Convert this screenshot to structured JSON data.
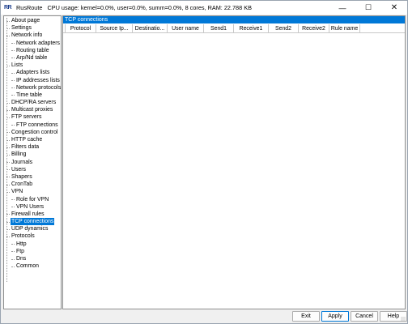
{
  "window": {
    "app_name": "RusRoute",
    "icon_text": "RR",
    "status": "CPU usage: kernel=0.0%, user=0.0%, summ=0.0%, 8 cores,  RAM: 22.788 KB",
    "minimize": "—",
    "maximize": "☐",
    "close": "✕"
  },
  "tree": {
    "items": [
      {
        "label": "About page",
        "level": 0
      },
      {
        "label": "Settings",
        "level": 0
      },
      {
        "label": "Network info",
        "level": 0
      },
      {
        "label": "Network adapters",
        "level": 1
      },
      {
        "label": "Routing table",
        "level": 1
      },
      {
        "label": "Arp/Nd table",
        "level": 1
      },
      {
        "label": "Lists",
        "level": 0
      },
      {
        "label": "Adapters lists",
        "level": 1
      },
      {
        "label": "IP addresses lists",
        "level": 1
      },
      {
        "label": "Network protocols",
        "level": 1
      },
      {
        "label": "Time table",
        "level": 1
      },
      {
        "label": "DHCP/RA servers",
        "level": 0
      },
      {
        "label": "Multicast proxies",
        "level": 0
      },
      {
        "label": "FTP servers",
        "level": 0
      },
      {
        "label": "FTP connections",
        "level": 1
      },
      {
        "label": "Congestion control",
        "level": 0
      },
      {
        "label": "HTTP cache",
        "level": 0
      },
      {
        "label": "Filters data",
        "level": 0
      },
      {
        "label": "Billing",
        "level": 0
      },
      {
        "label": "Journals",
        "level": 0
      },
      {
        "label": "Users",
        "level": 0
      },
      {
        "label": "Shapers",
        "level": 0
      },
      {
        "label": "CronTab",
        "level": 0
      },
      {
        "label": "VPN",
        "level": 0
      },
      {
        "label": "Role for VPN",
        "level": 1
      },
      {
        "label": "VPN Users",
        "level": 1
      },
      {
        "label": "Firewall rules",
        "level": 0
      },
      {
        "label": "TCP connections",
        "level": 0,
        "selected": true
      },
      {
        "label": "UDP dynamics",
        "level": 0
      },
      {
        "label": "Protocols",
        "level": 0
      },
      {
        "label": "Http",
        "level": 1
      },
      {
        "label": "Ftp",
        "level": 1
      },
      {
        "label": "Dns",
        "level": 1
      },
      {
        "label": "Common",
        "level": 1
      }
    ]
  },
  "main": {
    "title": "TCP connections",
    "columns": [
      "Protocol",
      "Source Ip...",
      "Destinatio...",
      "User name",
      "Send1",
      "Receive1",
      "Send2",
      "Receive2",
      "Rule name"
    ]
  },
  "buttons": {
    "exit": "Exit",
    "apply": "Apply",
    "cancel": "Cancel",
    "help": "Help"
  },
  "colors": {
    "accent": "#0078d7",
    "border": "#8e8f8f"
  }
}
